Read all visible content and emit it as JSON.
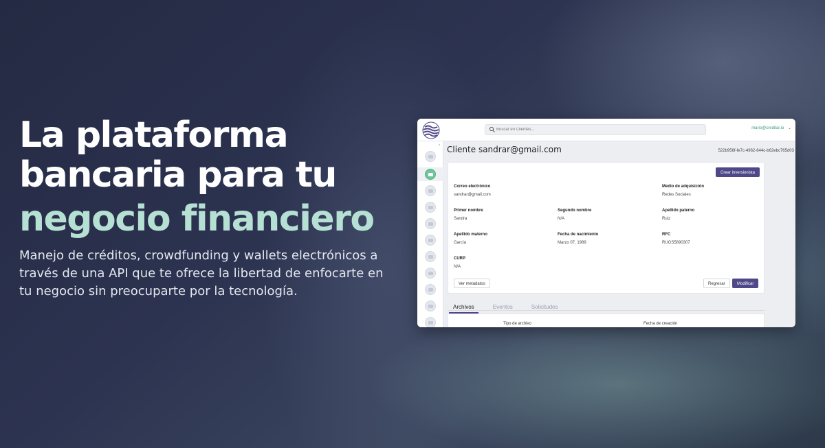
{
  "hero": {
    "title_line1": "La plataforma",
    "title_line2": "bancaria para tu",
    "title_accent": "negocio financiero",
    "description": "Manejo de créditos, crowdfunding y wallets electrónicos a través de una API que te ofrece la libertad de enfocarte en tu negocio sin preocuparte por la tecnología."
  },
  "app": {
    "search": {
      "placeholder": "Buscar en Clientes..."
    },
    "user": {
      "email": "mario@creditar.io"
    },
    "page": {
      "title": "Cliente sandrar@gmail.com",
      "id": "522b956f-fe7c-4962-844c-b62ebc765d03"
    },
    "buttons": {
      "create_investor": "Crear inversionista",
      "metadata": "Ver metadatos",
      "back": "Regresar",
      "edit": "Modificar"
    },
    "fields": {
      "email": {
        "label": "Correo electrónico",
        "value": "sandrar@gmail.com"
      },
      "acquisition": {
        "label": "Medio de adquisición",
        "value": "Redes Sociales"
      },
      "first_name": {
        "label": "Primer nombre",
        "value": "Sandra"
      },
      "second_name": {
        "label": "Segundo nombre",
        "value": "N/A"
      },
      "father_surname": {
        "label": "Apellido paterno",
        "value": "Ruiz"
      },
      "mother_surname": {
        "label": "Apellido materno",
        "value": "García"
      },
      "birth_date": {
        "label": "Fecha de nacimiento",
        "value": "Marzo 07, 1989"
      },
      "rfc": {
        "label": "RFC",
        "value": "RUGS5890307"
      },
      "curp": {
        "label": "CURP",
        "value": "N/A"
      }
    },
    "tabs": [
      "Archivos",
      "Eventos",
      "Solicitudes"
    ],
    "table": {
      "headers": [
        "Tipo de archivo",
        "Fecha de creación"
      ]
    }
  },
  "colors": {
    "accent": "#4f4888",
    "hero_accent": "#b5e0d3",
    "active": "#6cc69a"
  }
}
